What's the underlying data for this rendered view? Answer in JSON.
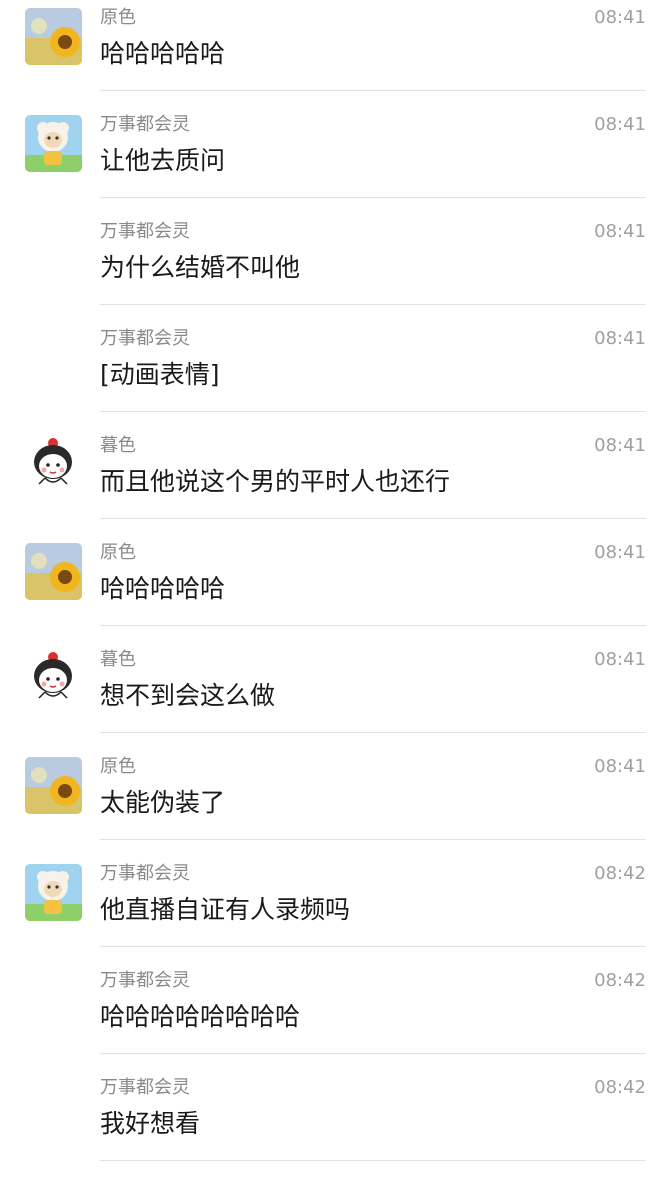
{
  "messages": [
    {
      "sender": "原色",
      "time": "08:41",
      "text": "哈哈哈哈哈",
      "avatar": "sunflower-avatar"
    },
    {
      "sender": "万事都会灵",
      "time": "08:41",
      "text": "让他去质问",
      "avatar": "sheep-avatar"
    },
    {
      "sender": "万事都会灵",
      "time": "08:41",
      "text": "为什么结婚不叫他",
      "avatar": null
    },
    {
      "sender": "万事都会灵",
      "time": "08:41",
      "text": "[动画表情]",
      "avatar": null
    },
    {
      "sender": "暮色",
      "time": "08:41",
      "text": "而且他说这个男的平时人也还行",
      "avatar": "cartoon-girl-avatar"
    },
    {
      "sender": "原色",
      "time": "08:41",
      "text": "哈哈哈哈哈",
      "avatar": "sunflower-avatar"
    },
    {
      "sender": "暮色",
      "time": "08:41",
      "text": "想不到会这么做",
      "avatar": "cartoon-girl-avatar"
    },
    {
      "sender": "原色",
      "time": "08:41",
      "text": "太能伪装了",
      "avatar": "sunflower-avatar"
    },
    {
      "sender": "万事都会灵",
      "time": "08:42",
      "text": "他直播自证有人录频吗",
      "avatar": "sheep-avatar"
    },
    {
      "sender": "万事都会灵",
      "time": "08:42",
      "text": "哈哈哈哈哈哈哈哈",
      "avatar": null
    },
    {
      "sender": "万事都会灵",
      "time": "08:42",
      "text": "我好想看",
      "avatar": null
    }
  ]
}
